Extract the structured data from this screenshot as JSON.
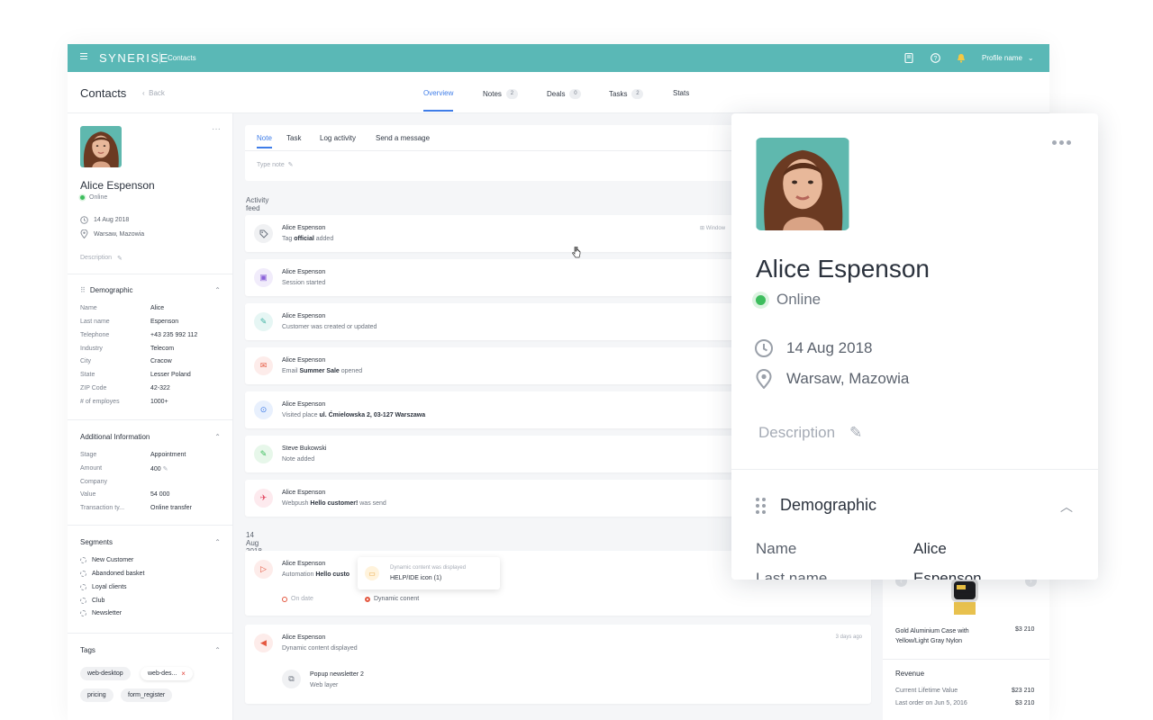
{
  "topbar": {
    "logo": "SYNERISE",
    "breadcrumb": "Contacts",
    "profile_label": "Profile name"
  },
  "header": {
    "title": "Contacts",
    "back_label": "Back",
    "tabs": [
      {
        "label": "Overview",
        "count": ""
      },
      {
        "label": "Notes",
        "count": "2"
      },
      {
        "label": "Deals",
        "count": "0"
      },
      {
        "label": "Tasks",
        "count": "2"
      },
      {
        "label": "Stats",
        "count": ""
      }
    ]
  },
  "profile": {
    "name": "Alice Espenson",
    "status": "Online",
    "date": "14 Aug 2018",
    "location": "Warsaw, Mazowia",
    "description_label": "Description"
  },
  "demographic": {
    "title": "Demographic",
    "fields": [
      {
        "key": "Name",
        "value": "Alice"
      },
      {
        "key": "Last name",
        "value": "Espenson"
      },
      {
        "key": "Telephone",
        "value": "+43 235 992 112"
      },
      {
        "key": "Industry",
        "value": "Telecom"
      },
      {
        "key": "City",
        "value": "Cracow"
      },
      {
        "key": "State",
        "value": "Lesser Poland"
      },
      {
        "key": "ZIP Code",
        "value": "42-322"
      },
      {
        "key": "# of employes",
        "value": "1000+"
      }
    ]
  },
  "additional": {
    "title": "Additional Information",
    "fields": [
      {
        "key": "Stage",
        "value": "Appointment"
      },
      {
        "key": "Amount",
        "value": "400"
      },
      {
        "key": "Company",
        "value": ""
      },
      {
        "key": "Value",
        "value": "54 000"
      },
      {
        "key": "Transaction ty...",
        "value": "Online transfer"
      }
    ]
  },
  "segments": {
    "title": "Segments",
    "items": [
      "New Customer",
      "Abandoned basket",
      "Loyal clients",
      "Club",
      "Newsletter"
    ]
  },
  "tags": {
    "title": "Tags",
    "items": [
      "web-desktop",
      "web-des...",
      "pricing",
      "form_register"
    ]
  },
  "composer": {
    "tabs": [
      "Note",
      "Task",
      "Log activity",
      "Send a message"
    ],
    "placeholder": "Type note"
  },
  "feed": {
    "title": "Activity feed",
    "items": [
      {
        "who": "Alice Espenson",
        "pre": "Tag ",
        "bold": "official",
        "post": " added",
        "time": "Window"
      },
      {
        "who": "Alice Espenson",
        "pre": "Session started",
        "bold": "",
        "post": "",
        "time": ""
      },
      {
        "who": "Alice Espenson",
        "pre": "Customer was created or updated",
        "bold": "",
        "post": "",
        "time": ""
      },
      {
        "who": "Alice Espenson",
        "pre": "Email ",
        "bold": "Summer Sale",
        "post": " opened",
        "time": ""
      },
      {
        "who": "Alice Espenson",
        "pre": "Visited place ",
        "bold": "ul. Ćmielowska 2, 03-127 Warszawa",
        "post": "",
        "time": ""
      },
      {
        "who": "Steve Bukowski",
        "pre": "Note added",
        "bold": "",
        "post": "",
        "time": ""
      },
      {
        "who": "Alice Espenson",
        "pre": "Webpush ",
        "bold": "Hello customer!",
        "post": " was send",
        "time": ""
      }
    ],
    "date_header": "14 Aug 2018",
    "automation": {
      "who": "Alice Espenson",
      "pre": "Automation ",
      "bold": "Hello custo",
      "tooltip_title": "Dynamic content was displayed",
      "tooltip_value": "HELP/IDE icon (1)",
      "step1": "On date",
      "step2": "Dynamic conent"
    },
    "dynamic": {
      "who": "Alice Espenson",
      "text": "Dynamic content displayed",
      "time": "3 days ago",
      "sub_title": "Popup newsletter 2",
      "sub_text": "Web layer"
    }
  },
  "product": {
    "name": "Gold Aluminium Case with Yellow/Light Gray Nylon",
    "price": "$3 210"
  },
  "revenue": {
    "title": "Revenue",
    "rows": [
      {
        "label": "Current Lifetime Value",
        "value": "$23 210"
      },
      {
        "label": "Last order on Jun 5, 2016",
        "value": "$3 210"
      }
    ]
  },
  "colors": {
    "topbar": "#5ab8b6",
    "accent": "#3f7de8",
    "online": "#3dbd5d"
  }
}
